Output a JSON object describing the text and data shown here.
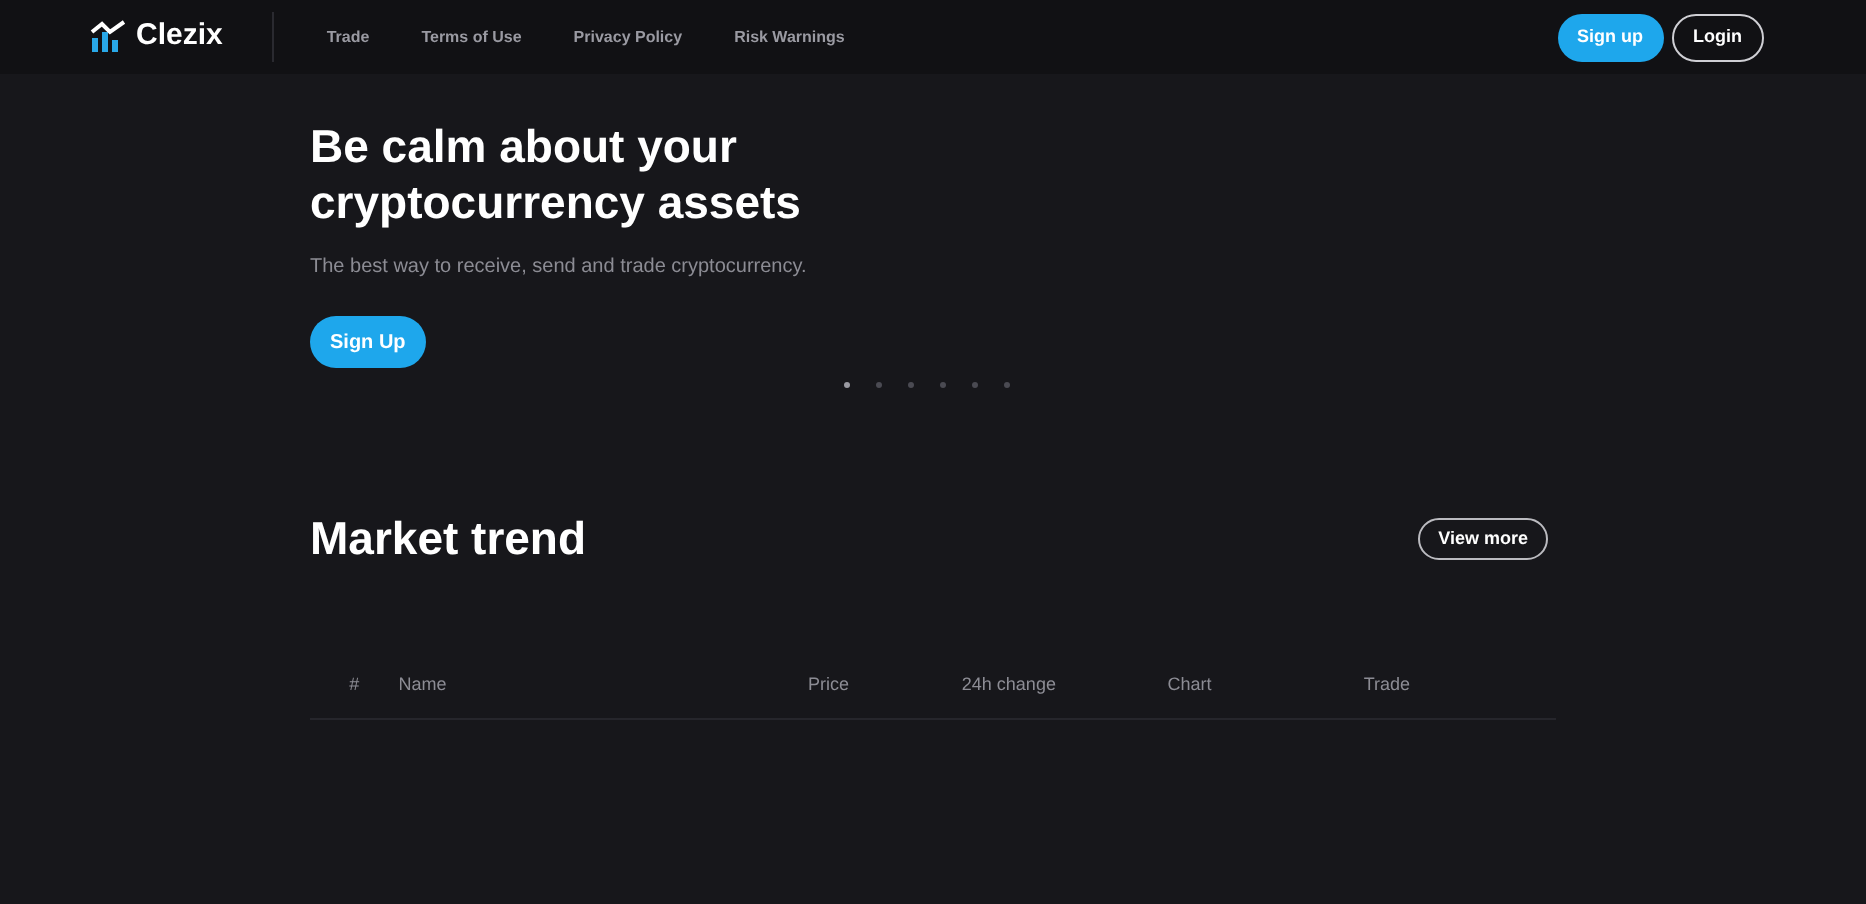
{
  "header": {
    "logo": "Clezix",
    "nav": [
      {
        "label": "Trade"
      },
      {
        "label": "Terms of Use"
      },
      {
        "label": "Privacy Policy"
      },
      {
        "label": "Risk Warnings"
      }
    ],
    "signup": "Sign up",
    "login": "Login"
  },
  "hero": {
    "title_lines": [
      "Be calm about your",
      "cryptocurrency assets"
    ],
    "subtitle": "The best way to receive, send and trade cryptocurrency.",
    "button": "Sign Up",
    "dots": [
      {
        "selected": true
      },
      {
        "selected": false
      },
      {
        "selected": false
      },
      {
        "selected": false
      },
      {
        "selected": false
      },
      {
        "selected": false
      }
    ]
  },
  "market": {
    "title": "Market trend",
    "view_more": "View more",
    "columns": [
      "#",
      "Name",
      "Price",
      "24h change",
      "Chart",
      "Trade"
    ]
  }
}
